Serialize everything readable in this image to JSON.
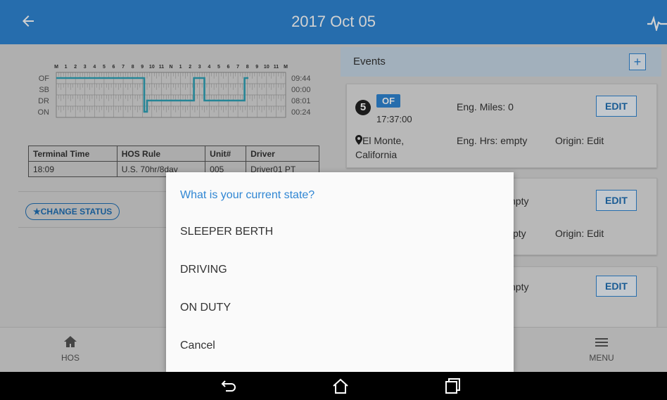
{
  "header": {
    "title": "2017 Oct 05",
    "back_icon": "arrow-left-icon",
    "pulse_icon": "heartbeat-icon"
  },
  "graph": {
    "hour_labels": [
      "M",
      "1",
      "2",
      "3",
      "4",
      "5",
      "6",
      "7",
      "8",
      "9",
      "10",
      "11",
      "N",
      "1",
      "2",
      "3",
      "4",
      "5",
      "6",
      "7",
      "8",
      "9",
      "10",
      "11",
      "M"
    ],
    "rows": [
      {
        "code": "OF",
        "total": "09:44"
      },
      {
        "code": "SB",
        "total": "00:00"
      },
      {
        "code": "DR",
        "total": "08:01"
      },
      {
        "code": "ON",
        "total": "00:24"
      }
    ],
    "line_color": "#2fa3b7"
  },
  "hos_table": {
    "headers": [
      "Terminal Time",
      "HOS Rule",
      "Unit#",
      "Driver"
    ],
    "row": [
      "18:09",
      "U.S. 70hr/8day",
      "005",
      "Driver01 PT"
    ]
  },
  "change_status_label": "★CHANGE STATUS",
  "events": {
    "label": "Events",
    "add_label": "+",
    "card1": {
      "number": "5",
      "status": "OF",
      "time": "17:37:00",
      "location": "El Monte, California",
      "miles": "Eng. Miles: 0",
      "hours": "Eng. Hrs: empty",
      "origin": "Origin: Edit",
      "edit": "EDIT"
    },
    "card2": {
      "partial_top": "npty",
      "partial_bottom": "pty",
      "origin": "Origin: Edit",
      "edit": "EDIT"
    },
    "card3": {
      "partial_top": "npty",
      "edit": "EDIT"
    }
  },
  "nav": {
    "hos_label": "HOS",
    "menu_label": "MENU"
  },
  "dialog": {
    "question": "What is your current state?",
    "options": [
      "SLEEPER BERTH",
      "DRIVING",
      "ON DUTY",
      "Cancel"
    ]
  },
  "colors": {
    "primary": "#2f86d3",
    "dialog_bg": "#fafafa"
  }
}
